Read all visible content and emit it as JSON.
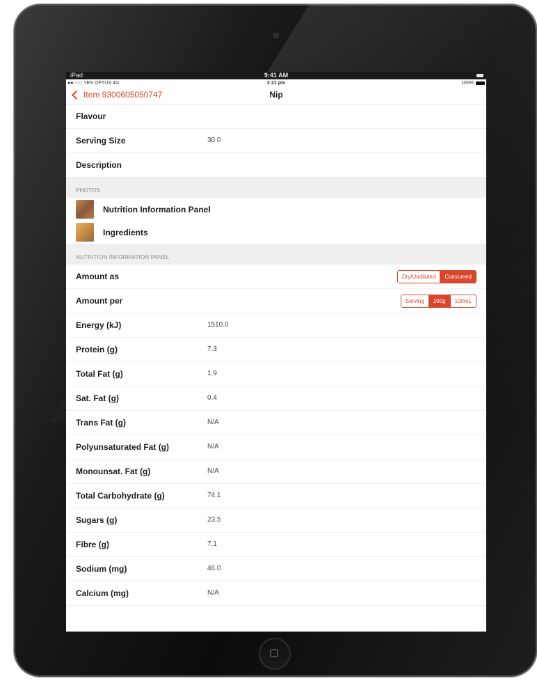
{
  "device_status": {
    "device": "iPad",
    "time": "9:41 AM"
  },
  "app_status": {
    "carrier": "●●○○○ YES OPTUS  4G",
    "time": "3:21 pm",
    "battery": "100%"
  },
  "nav": {
    "back_label": "Item 9300605050747",
    "title": "Nip"
  },
  "details": [
    {
      "label": "Flavour",
      "value": ""
    },
    {
      "label": "Serving Size",
      "value": "30.0"
    },
    {
      "label": "Description",
      "value": ""
    }
  ],
  "photos_header": "PHOTOS",
  "photos": [
    {
      "label": "Nutrition Information Panel"
    },
    {
      "label": "Ingredients"
    }
  ],
  "nutrition_header": "NUTRITION INFORMATION PANEL",
  "amount_as": {
    "label": "Amount as",
    "options": [
      "Dry/Undiluted",
      "Consumed"
    ],
    "selected": "Consumed"
  },
  "amount_per": {
    "label": "Amount per",
    "options": [
      "Serving",
      "100g",
      "100mL"
    ],
    "selected": "100g"
  },
  "nutrients": [
    {
      "label": "Energy (kJ)",
      "value": "1510.0"
    },
    {
      "label": "Protein (g)",
      "value": "7.3"
    },
    {
      "label": "Total Fat (g)",
      "value": "1.9"
    },
    {
      "label": "Sat. Fat (g)",
      "value": "0.4"
    },
    {
      "label": "Trans Fat (g)",
      "value": "N/A"
    },
    {
      "label": "Polyunsaturated Fat (g)",
      "value": "N/A"
    },
    {
      "label": "Monounsat. Fat (g)",
      "value": "N/A"
    },
    {
      "label": "Total Carbohydrate (g)",
      "value": "74.1"
    },
    {
      "label": "Sugars (g)",
      "value": "23.5"
    },
    {
      "label": "Fibre (g)",
      "value": "7.1"
    },
    {
      "label": "Sodium (mg)",
      "value": "46.0"
    },
    {
      "label": "Calcium (mg)",
      "value": "N/A"
    }
  ],
  "colors": {
    "accent": "#d9462b",
    "section_bg": "#efefef",
    "bezel": "#1a1a1a"
  },
  "icons": {
    "back": "chevron-left-icon",
    "home": "home-button-icon",
    "camera": "camera-icon",
    "battery": "battery-icon"
  }
}
